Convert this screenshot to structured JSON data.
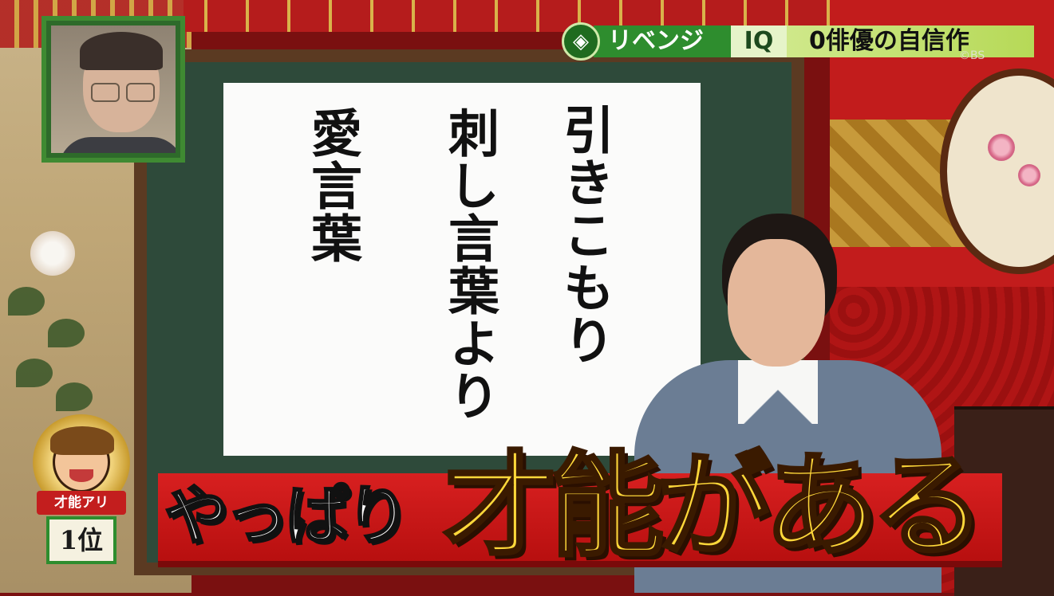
{
  "banner": {
    "seal_icon": "green-diamond-crest-icon",
    "revenge": "リベンジ",
    "iq": "IQ",
    "title": "0俳優の自信作"
  },
  "channel_logo": "©BS",
  "poem": {
    "line1": "引きこもり",
    "line2": "刺し言葉より",
    "line3": "愛言葉"
  },
  "badge": {
    "ribbon": "才能アリ",
    "rank": "1位"
  },
  "caption": {
    "small": "やっぱり",
    "big": "才能がある"
  },
  "colors": {
    "caption_bar": "#c81414",
    "caption_big_text": "#ffd83a",
    "banner_green": "#2e8d2e",
    "banner_lime": "#b6d957"
  }
}
